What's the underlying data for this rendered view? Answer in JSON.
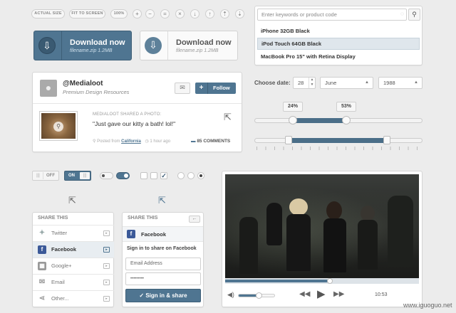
{
  "toolbar": {
    "actual_size": "ACTUAL SIZE",
    "fit_to_screen": "FIT TO SCREEN",
    "zoom": "100%"
  },
  "download_primary": {
    "title": "Download now",
    "subtitle": "filename.zip 1.2MB"
  },
  "download_secondary": {
    "title": "Download now",
    "subtitle": "filename.zip 1.2MB"
  },
  "search": {
    "placeholder": "Enter keywords or product code",
    "results": [
      "iPhone 32GB Black",
      "iPod Touch 64GB Black",
      "MacBook Pro 15\" with Retina Display"
    ],
    "selected_index": 1
  },
  "profile": {
    "name": "@Medialoot",
    "tagline": "Premium Design Resources",
    "follow_label": "Follow"
  },
  "post": {
    "header": "MEDIALOOT SHARED A PHOTO:",
    "quote": "\"Just gave our kitty a bath! lol!\"",
    "posted_prefix": "Posted from",
    "posted_source": "California",
    "time": "1 hour ago",
    "comments": "85 COMMENTS"
  },
  "date": {
    "label": "Choose date:",
    "day": "28",
    "month": "June",
    "year": "1988"
  },
  "sliders": {
    "single_start_label": "24%",
    "single_end_label": "53%",
    "single_start": 0.24,
    "single_end": 0.53
  },
  "toggles": {
    "off_label": "OFF",
    "on_label": "ON"
  },
  "share_list": {
    "title": "SHARE THIS",
    "items": [
      "Twitter",
      "Facebook",
      "Google+",
      "Email",
      "Other..."
    ],
    "active_index": 1
  },
  "share_facebook": {
    "title": "SHARE THIS",
    "network": "Facebook",
    "prompt": "Sign in to share on Facebook",
    "email_placeholder": "Email Address",
    "password_value": "•••••••••",
    "button": "Sign in & share"
  },
  "video": {
    "time": "10:53",
    "progress": 0.54,
    "volume": 0.55
  },
  "watermark": "www.iguoguo.net",
  "colors": {
    "accent": "#4a6e88",
    "facebook": "#3b5998",
    "twitter": "#55acee"
  }
}
